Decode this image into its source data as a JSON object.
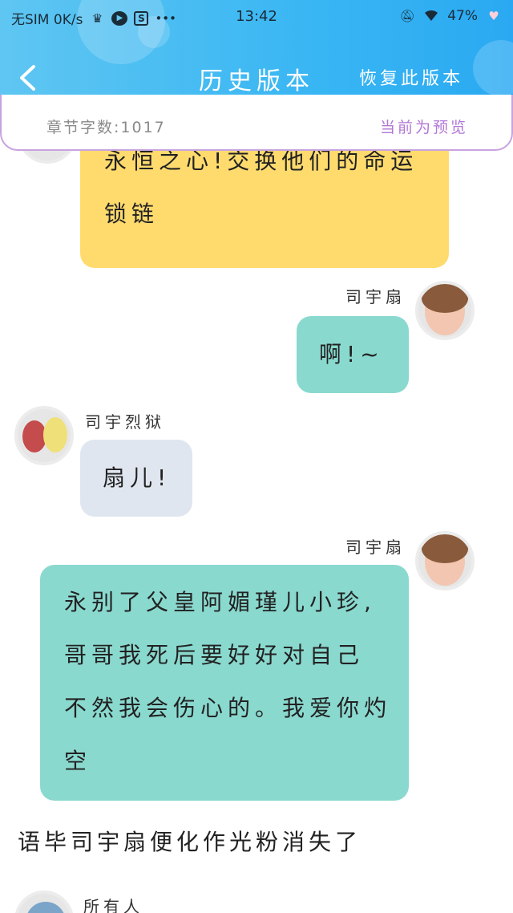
{
  "status_bar": {
    "carrier": "无SIM 0K/s",
    "time": "13:42",
    "battery": "47%"
  },
  "header": {
    "back_icon": "back-arrow-icon",
    "title": "历史版本",
    "restore_label": "恢复此版本"
  },
  "info_bar": {
    "word_count": "章节字数:1017",
    "preview_status": "当前为预览"
  },
  "messages": [
    {
      "speaker": "",
      "text_lines": [
        "永恒之心!交换他们的命运",
        "锁链"
      ]
    },
    {
      "speaker": "司宇扇",
      "text_lines": [
        "啊!~"
      ]
    },
    {
      "speaker": "司宇烈狱",
      "text_lines": [
        "扇儿!"
      ]
    },
    {
      "speaker": "司宇扇",
      "text_lines": [
        "永别了父皇阿媚瑾儿小珍,",
        "哥哥我死后要好好对自己",
        "不然我会伤心的。我爱你灼",
        "空"
      ]
    },
    {
      "speaker": "所有人",
      "text_lines": []
    }
  ],
  "narration": "语毕司宇扇便化作光粉消失了",
  "colors": {
    "header": "#39b6f3",
    "yellow_bubble": "#ffdb6e",
    "teal_bubble": "#8ad9cf",
    "grey_bubble": "#e0e6ef",
    "preview_purple": "#b277d6"
  }
}
